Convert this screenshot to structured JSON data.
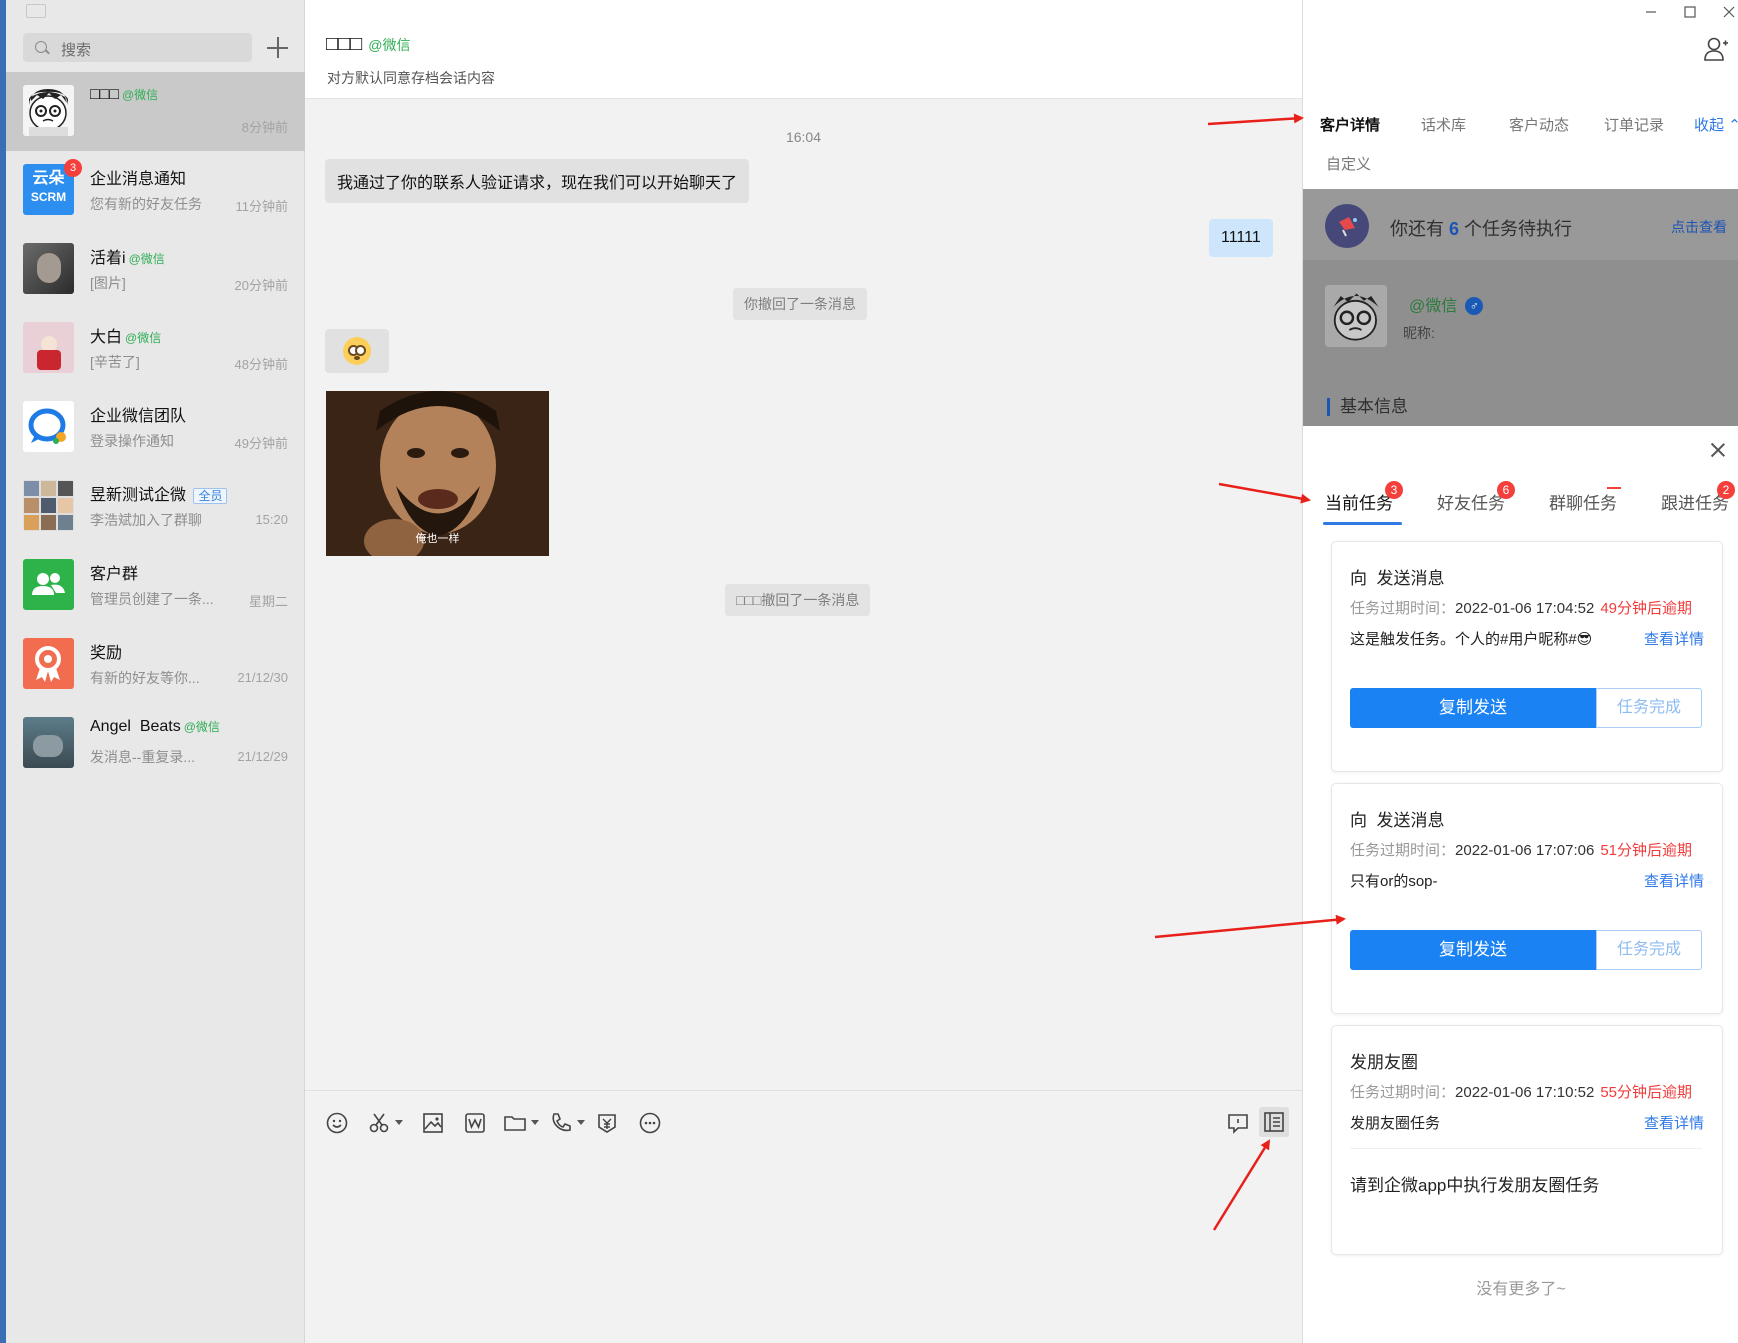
{
  "search": {
    "placeholder": "搜索"
  },
  "sessions": [
    {
      "name": "□□□",
      "tag": "@微信",
      "sub": "",
      "time": "8分钟前",
      "badge": ""
    },
    {
      "name": "企业消息通知",
      "tag": "",
      "sub": "您有新的好友任务",
      "time": "11分钟前",
      "badge": "3",
      "avatar_text": "云朵\nSCRM"
    },
    {
      "name": "活着i",
      "tag": "@微信",
      "sub": "[图片]",
      "time": "20分钟前",
      "badge": ""
    },
    {
      "name": "大白",
      "tag": "@微信",
      "sub": "[辛苦了]",
      "time": "48分钟前",
      "badge": ""
    },
    {
      "name": "企业微信团队",
      "tag": "",
      "sub": "登录操作通知",
      "time": "49分钟前",
      "badge": ""
    },
    {
      "name": "昱新测试企微",
      "tag": "全员",
      "sub": "李浩斌加入了群聊",
      "time": "15:20",
      "badge": ""
    },
    {
      "name": "客户群",
      "tag": "",
      "sub": "管理员创建了一条...",
      "time": "星期二",
      "badge": ""
    },
    {
      "name": "奖励",
      "tag": "",
      "sub": "有新的好友等你...",
      "time": "21/12/30",
      "badge": ""
    },
    {
      "name": "Angel  Beats",
      "tag": "@微信",
      "sub": "发消息--重复录...",
      "time": "21/12/29",
      "badge": ""
    }
  ],
  "chat": {
    "title": "□□□",
    "title_tag": "@微信",
    "subtitle": "对方默认同意存档会话内容",
    "time": "16:04",
    "msg_verify": "我通过了你的联系人验证请求，现在我们可以开始聊天了",
    "msg_sent": "11111",
    "sys_recall_self": "你撤回了一条消息",
    "sys_recall_other": "□□□撤回了一条消息",
    "meme_caption": "俺也一样"
  },
  "side": {
    "tabs": [
      "客户详情",
      "话术库",
      "客户动态",
      "订单记录",
      "收起",
      "自定义"
    ],
    "notice_prefix": "你还有",
    "notice_count": "6",
    "notice_suffix": "个任务待执行",
    "notice_link": "点击查看",
    "profile_tag": "@微信",
    "gender": "♂",
    "nick_label": "昵称:",
    "base_info": "基本信息",
    "task_tabs": [
      {
        "label": "当前任务",
        "badge": "3"
      },
      {
        "label": "好友任务",
        "badge": "6"
      },
      {
        "label": "群聊任务",
        "badge": ""
      },
      {
        "label": "跟进任务",
        "badge": "2"
      }
    ],
    "tasks": [
      {
        "title": "向  发送消息",
        "expire_label": "任务过期时间：",
        "expire": "2022-01-06 17:04:52",
        "overdue": "49分钟后逾期",
        "content": "这是触发任务。个人的#用户昵称#😎",
        "detail": "查看详情",
        "copy": "复制发送",
        "done": "任务完成"
      },
      {
        "title": "向  发送消息",
        "expire_label": "任务过期时间：",
        "expire": "2022-01-06 17:07:06",
        "overdue": "51分钟后逾期",
        "content": "只有or的sop-",
        "detail": "查看详情",
        "copy": "复制发送",
        "done": "任务完成"
      },
      {
        "title": "发朋友圈",
        "expire_label": "任务过期时间：",
        "expire": "2022-01-06 17:10:52",
        "overdue": "55分钟后逾期",
        "content": "发朋友圈任务",
        "detail": "查看详情",
        "note": "请到企微app中执行发朋友圈任务"
      }
    ],
    "no_more": "没有更多了~"
  },
  "colors": {
    "accent": "#1b82f3",
    "overdue": "#f03c3c",
    "wechat_tag": "#2fae54",
    "arrow": "#e8201a"
  }
}
